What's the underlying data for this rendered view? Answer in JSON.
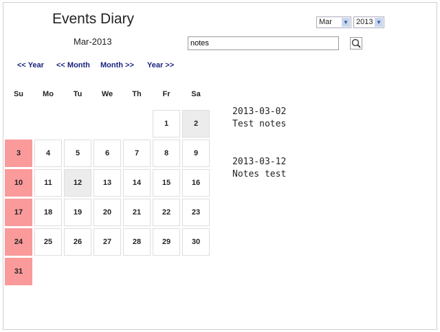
{
  "header": {
    "title": "Events Diary",
    "current_month": "Mar-2013"
  },
  "selectors": {
    "month": "Mar",
    "year": "2013"
  },
  "search": {
    "value": "notes"
  },
  "nav": {
    "prev_year": "<< Year",
    "prev_month": "<< Month",
    "next_month": "Month >>",
    "next_year": "Year >>"
  },
  "weekdays": [
    "Su",
    "Mo",
    "Tu",
    "We",
    "Th",
    "Fr",
    "Sa"
  ],
  "calendar": {
    "first_weekday": 5,
    "days_in_month": 31,
    "event_days": [
      2,
      12
    ]
  },
  "colors": {
    "weekend": "#fa9a9a",
    "event": "#ececec",
    "link": "#1a237e"
  },
  "events": [
    {
      "date": "2013-03-02",
      "text": "Test notes"
    },
    {
      "date": "2013-03-12",
      "text": "Notes test"
    }
  ]
}
